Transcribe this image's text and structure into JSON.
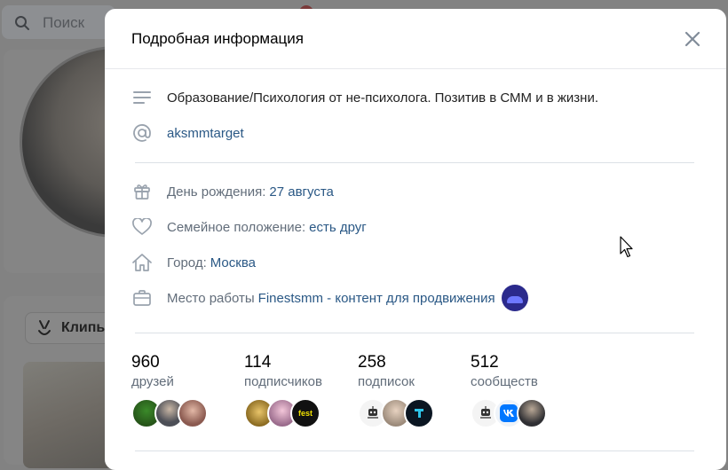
{
  "background": {
    "search_placeholder": "Поиск",
    "clips_label": "Клипы"
  },
  "modal": {
    "title": "Подробная информация",
    "status": "Образование/Психология от не-психолога. Позитив в СММ и в жизни.",
    "nickname": "aksmmtarget",
    "birthday": {
      "label": "День рождения:",
      "value": "27 августа"
    },
    "relationship": {
      "label": "Семейное положение:",
      "value": "есть друг"
    },
    "city": {
      "label": "Город:",
      "value": "Москва"
    },
    "work": {
      "label": "Место работы",
      "value": "Finestsmm - контент для продвижения"
    }
  },
  "stats": [
    {
      "count": "960",
      "caption": "друзей"
    },
    {
      "count": "114",
      "caption": "подписчиков"
    },
    {
      "count": "258",
      "caption": "подписок"
    },
    {
      "count": "512",
      "caption": "сообществ"
    }
  ],
  "avatar_texts": {
    "fest": "fest"
  },
  "colors": {
    "link": "#2a5885",
    "label": "#626d7a",
    "divider": "#dce1e6",
    "overlay": "#828282",
    "vk_blue": "#0077ff"
  }
}
